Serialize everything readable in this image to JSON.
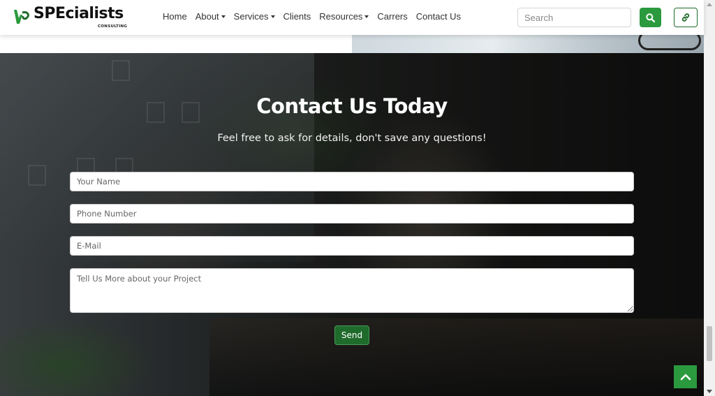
{
  "brand": {
    "name": "SPEcialists",
    "tagline": "CONSULTING",
    "accent_color": "#2b9a3e",
    "dark_green": "#1f6b2c"
  },
  "nav": {
    "items": [
      {
        "label": "Home",
        "dropdown": false
      },
      {
        "label": "About",
        "dropdown": true
      },
      {
        "label": "Services",
        "dropdown": true
      },
      {
        "label": "Clients",
        "dropdown": false
      },
      {
        "label": "Resources",
        "dropdown": true
      },
      {
        "label": "Carrers",
        "dropdown": false
      },
      {
        "label": "Contact Us",
        "dropdown": false
      }
    ],
    "search_placeholder": "Search",
    "search_icon": "search-icon",
    "link_icon": "link-icon"
  },
  "contact": {
    "title": "Contact Us Today",
    "subtitle": "Feel free to ask for details, don't save any questions!",
    "fields": {
      "name_placeholder": "Your Name",
      "phone_placeholder": "Phone Number",
      "email_placeholder": "E-Mail",
      "message_placeholder": "Tell Us More about your Project"
    },
    "send_label": "Send"
  },
  "back_to_top_icon": "chevron-up-icon"
}
